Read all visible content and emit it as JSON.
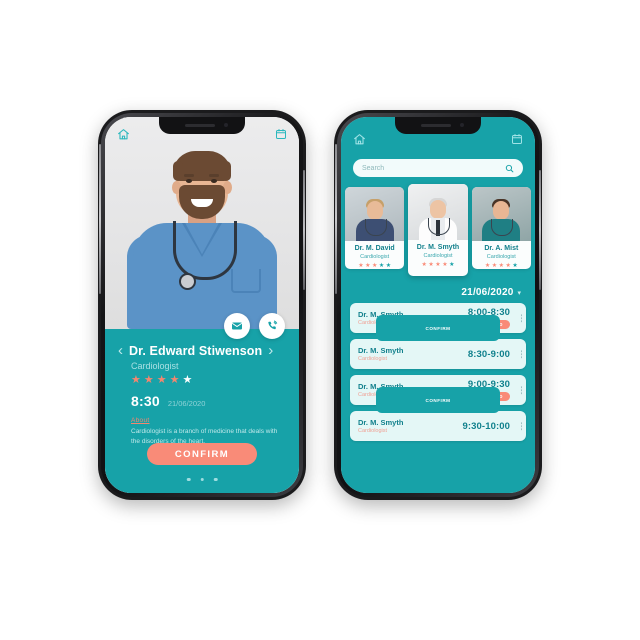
{
  "phone1": {
    "header": {
      "home_icon": "home-icon",
      "calendar_icon": "calendar-icon"
    },
    "actions": {
      "mail_icon": "mail-icon",
      "call_icon": "phone-call-icon"
    },
    "profile": {
      "prev_label": "‹",
      "next_label": "›",
      "name": "Dr. Edward Stiwenson",
      "specialty": "Cardiologist",
      "rating": 5,
      "stars": [
        "filled",
        "filled",
        "filled",
        "filled",
        "white"
      ],
      "time": "8:30",
      "date": "21/06/2020",
      "about_heading": "About",
      "about_body": "Cardiologist is a branch of medicine that deals with the disorders of the heart.",
      "confirm_label": "CONFIRM",
      "pagination_dots": 3
    }
  },
  "phone2": {
    "header": {
      "home_icon": "home-icon",
      "calendar_icon": "calendar-icon"
    },
    "search": {
      "placeholder": "Search",
      "icon": "search-icon"
    },
    "doctor_cards": [
      {
        "name": "Dr. M. David",
        "specialty": "Cardiologist",
        "stars": [
          "pink",
          "pink",
          "pink",
          "teal",
          "teal"
        ]
      },
      {
        "name": "Dr. M. Smyth",
        "specialty": "Cardiologist",
        "stars": [
          "pink",
          "pink",
          "pink",
          "pink",
          "teal"
        ]
      },
      {
        "name": "Dr. A. Mist",
        "specialty": "Cardiologist",
        "stars": [
          "pink",
          "pink",
          "pink",
          "pink",
          "teal"
        ]
      }
    ],
    "date_selector": {
      "date": "21/06/2020",
      "caret": "▾"
    },
    "appointments": [
      {
        "name": "Dr. M. Smyth",
        "specialty": "Cardiologist",
        "time": "8:00-8:30",
        "status": "BOOKED",
        "status_type": "booked"
      },
      {
        "name": "Dr. M. Smyth",
        "specialty": "Cardiologist",
        "time": "8:30-9:00",
        "status": "CONFIRM",
        "status_type": "confirm"
      },
      {
        "name": "Dr. M. Smyth",
        "specialty": "Cardiologist",
        "time": "9:00-9:30",
        "status": "BOOKED",
        "status_type": "booked"
      },
      {
        "name": "Dr. M. Smyth",
        "specialty": "Cardiologist",
        "time": "9:30-10:00",
        "status": "CONFIRM",
        "status_type": "confirm"
      }
    ]
  },
  "colors": {
    "teal": "#17a2a8",
    "teal_dark": "#11808c",
    "salmon": "#f98b78",
    "card_bg": "#e4f7f6",
    "screen_bg": "#e9e9ea",
    "white": "#ffffff"
  }
}
